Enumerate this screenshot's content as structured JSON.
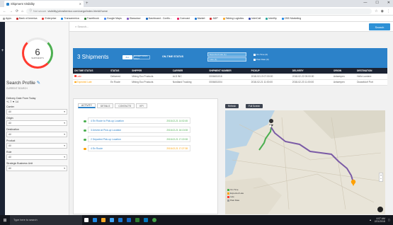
{
  "browser": {
    "tab_title": "Shipment Visibility",
    "url_secure_text": "Not secure",
    "url": "visibility.johnsitemicz.com/cargo/index.html#/home",
    "bookmarks": [
      "Apps",
      "Bank of America",
      "Enterprise",
      "Transamerica",
      "Travelbook",
      "Google Maps",
      "Glassdoor",
      "Dashboard - Conflu...",
      "Comcast",
      "Market",
      "ADP",
      "Talking Logistics",
      "InterCall",
      "Interflip",
      "CBS Marketing"
    ]
  },
  "sidebar": {
    "plus_label": "+"
  },
  "left_panel": {
    "gauge_value": "6",
    "gauge_label": "Shipments",
    "search_profile": "Search Profile",
    "current_search": "CURRENT SEARCH",
    "date_filter_label": "Delivery Date From Today",
    "date_filter_value": "+/- 7  ▼  14",
    "filters": [
      {
        "label": "Carrier",
        "value": "All"
      },
      {
        "label": "Origin",
        "value": "All"
      },
      {
        "label": "Destination",
        "value": "All"
      },
      {
        "label": "Product",
        "value": "All"
      },
      {
        "label": "Role",
        "value": "All"
      },
      {
        "label": "Strategic Business Unit",
        "value": "All"
      }
    ]
  },
  "header": {
    "search_placeholder": "Search...",
    "search_button": "Search"
  },
  "summary": {
    "shipments_label": "3 Shipments",
    "btn_all": "ALL",
    "btn_exceptions": "EXCEPTIONS ONLY",
    "ontime_status_label": "ON-TIME STATUS",
    "check1": "Expected Late (1)",
    "check2": "Late (1)",
    "opt1": "On-Time (0)",
    "opt2": "Past Date (0)"
  },
  "table": {
    "headers": [
      "ON TIME STATUS",
      "STATUS",
      "SHIPPER",
      "CARRIER",
      "SHIPMENT NUMBER",
      "PICKUP",
      "DELIVERY",
      "ORIGIN",
      "DESTINATION"
    ],
    "rows": [
      {
        "status_dot": "#ff3b30",
        "cells": [
          "Late",
          "Delivered",
          "Mining Eco Products",
          "ALD INC",
          "0006451016",
          "2018-02-19 07:00:00",
          "2018-02-22 05:00:00",
          "Antwerpen",
          "Hello Lumiere"
        ]
      },
      {
        "status_dot": "#ffa000",
        "cells": [
          "Expected Late",
          "En Route",
          "Mining Eco Products",
          "Nordland Trucking",
          "0006451004",
          "2018-02-21 11:00:00",
          "2018-02-23 11:00:00",
          "Antwerpen",
          "Dusseldorf Port"
        ]
      }
    ]
  },
  "detail": {
    "tabs": [
      "ACTIVITY",
      "DETAILS",
      "CONTACTS",
      "KPI"
    ],
    "events": [
      {
        "text": "4 En Route to Pick-up Location",
        "time": "2018-02-21 14:02:45",
        "dot": "#4caf50"
      },
      {
        "text": "3 Arrived at Pick-up Location",
        "time": "2018-02-21 16:13:08",
        "dot": "#4caf50"
      },
      {
        "text": "2 Departed Pick-up Location",
        "time": "2018-02-21 17:22:08",
        "dot": "#4caf50"
      },
      {
        "text": "4 En Route",
        "time": "2018-02-21 17:27:38",
        "dot": "#ffa000"
      }
    ]
  },
  "map": {
    "refresh_label": "Refresh",
    "fullscreen_label": "Full Screen",
    "legend": [
      "On-Time",
      "Expected Late",
      "Late",
      "Past Date"
    ],
    "legend_colors": [
      "#4caf50",
      "#ffa000",
      "#ff3b30",
      "#9e9e9e"
    ],
    "zoom_in": "+",
    "zoom_out": "−"
  },
  "taskbar": {
    "search_placeholder": "Type here to search",
    "time": "4:07 AM",
    "date": "2/21/2018"
  }
}
